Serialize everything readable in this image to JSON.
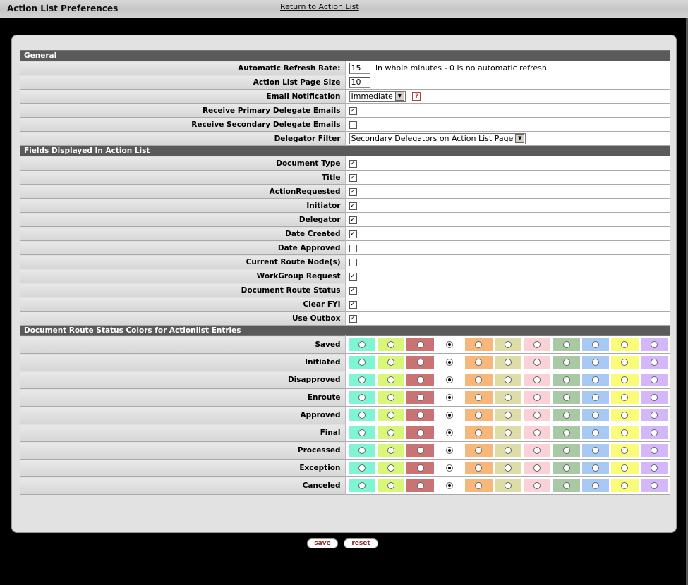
{
  "header": {
    "title": "Action List Preferences",
    "return_link": "Return to Action List"
  },
  "general": {
    "section_title": "General",
    "refresh_rate": {
      "label": "Automatic Refresh Rate:",
      "value": "15",
      "hint": "in whole minutes - 0 is no automatic refresh."
    },
    "page_size": {
      "label": "Action List Page Size",
      "value": "10"
    },
    "email_notification": {
      "label": "Email Notification",
      "selected": "Immediate",
      "help_icon": "?"
    },
    "primary_delegate": {
      "label": "Receive Primary Delegate Emails",
      "checked": true
    },
    "secondary_delegate": {
      "label": "Receive Secondary Delegate Emails",
      "checked": false
    },
    "delegator_filter": {
      "label": "Delegator Filter",
      "selected": "Secondary Delegators on Action List Page"
    }
  },
  "fields": {
    "section_title": "Fields Displayed In Action List",
    "items": [
      {
        "label": "Document Type",
        "checked": true
      },
      {
        "label": "Title",
        "checked": true
      },
      {
        "label": "ActionRequested",
        "checked": true
      },
      {
        "label": "Initiator",
        "checked": true
      },
      {
        "label": "Delegator",
        "checked": true
      },
      {
        "label": "Date Created",
        "checked": true
      },
      {
        "label": "Date Approved",
        "checked": false
      },
      {
        "label": "Current Route Node(s)",
        "checked": false
      },
      {
        "label": "WorkGroup Request",
        "checked": true
      },
      {
        "label": "Document Route Status",
        "checked": true
      },
      {
        "label": "Clear FYI",
        "checked": true
      },
      {
        "label": "Use Outbox",
        "checked": true
      }
    ]
  },
  "colors": {
    "section_title": "Document Route Status Colors for Actionlist Entries",
    "palette": [
      "#80f5d6",
      "#d8f77a",
      "#c97375",
      "#ffffff",
      "#f8b77a",
      "#dedda8",
      "#f9d1d6",
      "#a8c9a4",
      "#a9c9f5",
      "#fbfb7a",
      "#d3b7f8"
    ],
    "selected_index": 3,
    "statuses": [
      "Saved",
      "Initiated",
      "Disapproved",
      "Enroute",
      "Approved",
      "Final",
      "Processed",
      "Exception",
      "Canceled"
    ]
  },
  "buttons": {
    "save": "save",
    "reset": "reset"
  }
}
